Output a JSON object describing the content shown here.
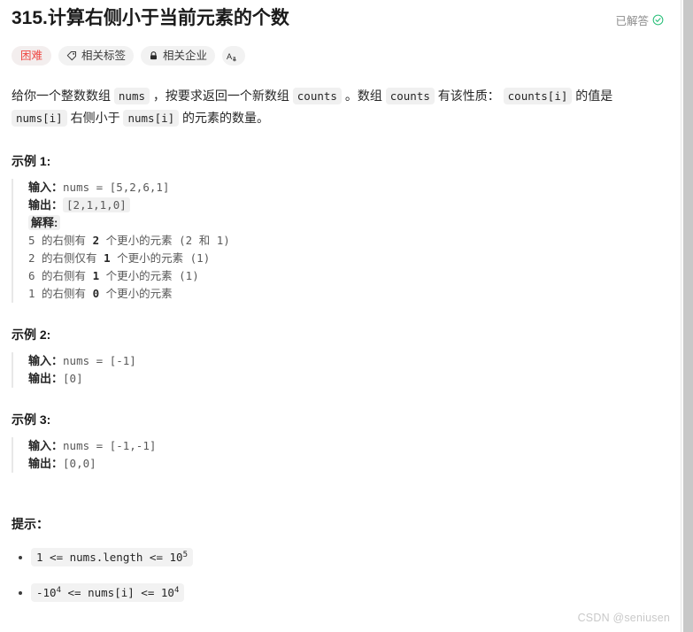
{
  "header": {
    "title": "315.计算右侧小于当前元素的个数",
    "status_label": "已解答",
    "status_icon": "check-circle-icon",
    "status_color": "#00af9b"
  },
  "tags": [
    {
      "label": "困难",
      "icon": null,
      "kind": "difficulty",
      "color": "#ef4743"
    },
    {
      "label": "相关标签",
      "icon": "tag-icon",
      "kind": "topics"
    },
    {
      "label": "相关企业",
      "icon": "lock-icon",
      "kind": "companies"
    },
    {
      "label": "Aa",
      "icon": "font-size-icon",
      "kind": "font-size"
    }
  ],
  "description": {
    "part1": "给你一个整数数组 ",
    "code1": "nums",
    "part2": " ，按要求返回一个新数组 ",
    "code2": "counts",
    "part3": " 。数组 ",
    "code3": "counts",
    "part4": " 有该性质： ",
    "code4": "counts[i]",
    "part5": " 的值是 ",
    "code5": "nums[i]",
    "part6": " 右侧小于 ",
    "code6": "nums[i]",
    "part7": " 的元素的数量。"
  },
  "examples": [
    {
      "title": "示例 1:",
      "input_label": "输入：",
      "input_value": "nums = [5,2,6,1]",
      "output_label": "输出：",
      "output_value": "[2,1,1,0]",
      "output_shaded": true,
      "explain_label": "解释:",
      "explain_lines": [
        {
          "pre": "5 的右侧有 ",
          "num": "2",
          "post": " 个更小的元素 (2 和 1)"
        },
        {
          "pre": "2 的右侧仅有 ",
          "num": "1",
          "post": " 个更小的元素 (1)"
        },
        {
          "pre": "6 的右侧有 ",
          "num": "1",
          "post": " 个更小的元素 (1)"
        },
        {
          "pre": "1 的右侧有 ",
          "num": "0",
          "post": " 个更小的元素"
        }
      ]
    },
    {
      "title": "示例 2:",
      "input_label": "输入：",
      "input_value": "nums = [-1]",
      "output_label": "输出：",
      "output_value": "[0]",
      "output_shaded": false,
      "explain_label": null,
      "explain_lines": []
    },
    {
      "title": "示例 3:",
      "input_label": "输入：",
      "input_value": "nums = [-1,-1]",
      "output_label": "输出：",
      "output_value": "[0,0]",
      "output_shaded": false,
      "explain_label": null,
      "explain_lines": []
    }
  ],
  "hints": {
    "title": "提示：",
    "items": [
      {
        "base": "1 <= nums.length <= 10",
        "sup": "5"
      },
      {
        "base": "-10",
        "sup": "4",
        "mid": " <= nums[i] <= 10",
        "sup2": "4"
      }
    ]
  },
  "watermark": "CSDN @seniusen"
}
